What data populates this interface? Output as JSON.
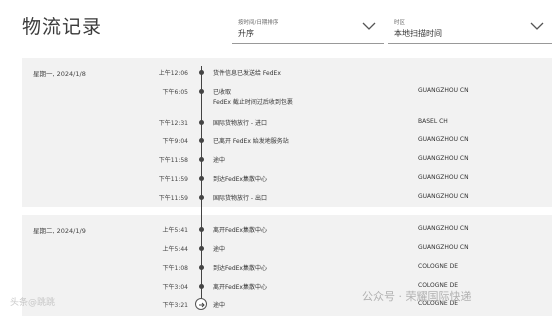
{
  "page_title": "物流记录",
  "sort_order": {
    "caption": "按时间/日期排序",
    "value": "升序",
    "icon": "chevron-down-icon"
  },
  "sort_tz": {
    "caption": "时区",
    "value": "本地扫描时间",
    "icon": "chevron-down-icon"
  },
  "days": [
    {
      "label": "星期一, 2024/1/8"
    },
    {
      "label": "星期二, 2024/1/9"
    }
  ],
  "events": [
    {
      "time": "上午12:06",
      "desc": "货件信息已发送给 FedEx",
      "desc2": "",
      "loc": ""
    },
    {
      "time": "下午6:05",
      "desc": "已收取",
      "desc2": "FedEx 截止时间过后收到包裹",
      "loc": "GUANGZHOU CN"
    },
    {
      "time": "下午12:31",
      "desc": "国际货物放行 - 进口",
      "desc2": "",
      "loc": "BASEL CH"
    },
    {
      "time": "下午9:04",
      "desc": "已离开 FedEx 始发地服务站",
      "desc2": "",
      "loc": "GUANGZHOU CN"
    },
    {
      "time": "下午11:58",
      "desc": "途中",
      "desc2": "",
      "loc": "GUANGZHOU CN"
    },
    {
      "time": "下午11:59",
      "desc": "到达FedEx集散中心",
      "desc2": "",
      "loc": "GUANGZHOU CN"
    },
    {
      "time": "下午11:59",
      "desc": "国际货物放行 - 出口",
      "desc2": "",
      "loc": "GUANGZHOU CN"
    },
    {
      "time": "上午5:41",
      "desc": "离开FedEx集散中心",
      "desc2": "",
      "loc": "GUANGZHOU CN"
    },
    {
      "time": "上午5:44",
      "desc": "途中",
      "desc2": "",
      "loc": "GUANGZHOU CN"
    },
    {
      "time": "下午1:08",
      "desc": "到达FedEx集散中心",
      "desc2": "",
      "loc": "COLOGNE DE"
    },
    {
      "time": "下午3:04",
      "desc": "离开FedEx集散中心",
      "desc2": "",
      "loc": "COLOGNE DE"
    },
    {
      "time": "下午3:21",
      "desc": "途中",
      "desc2": "",
      "loc": "COLOGNE DE"
    }
  ],
  "watermark_left": "头条@跳跳",
  "watermark_right": "公众号 · 荣耀国际快递"
}
